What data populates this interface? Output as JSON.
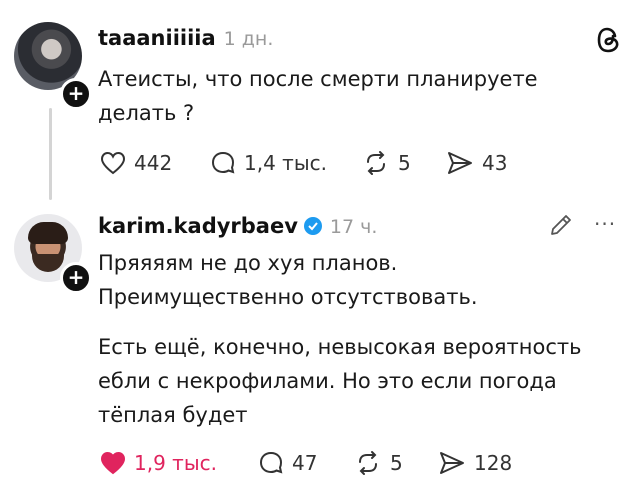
{
  "post1": {
    "username": "taaaniiiiia",
    "time": "1 дн.",
    "text_lines": [
      "Атеисты, что после смерти планируете",
      "делать ?"
    ],
    "likes": "442",
    "comments": "1,4 тыс.",
    "reposts": "5",
    "shares": "43"
  },
  "post2": {
    "username": "karim.kadyrbaev",
    "verified": true,
    "time": "17 ч.",
    "para1_lines": [
      "Пряяяям не до хуя планов.",
      "Преимущественно отсутствовать."
    ],
    "para2_lines": [
      "Есть ещё, конечно, невысокая вероятность",
      "ебли с некрофилами. Но это если погода",
      "тёплая будет"
    ],
    "likes": "1,9 тыс.",
    "liked": true,
    "comments": "47",
    "reposts": "5",
    "shares": "128"
  },
  "icons": {
    "like": "heart-icon",
    "comment": "speech-bubble-icon",
    "repost": "repost-icon",
    "share": "send-icon",
    "brand": "threads-logo-icon",
    "edit": "pencil-icon",
    "more": "more-icon",
    "follow": "plus-icon"
  },
  "colors": {
    "liked_heart": "#e0245e",
    "verified_badge": "#1d9bf0",
    "muted_text": "#9a9a9a"
  }
}
